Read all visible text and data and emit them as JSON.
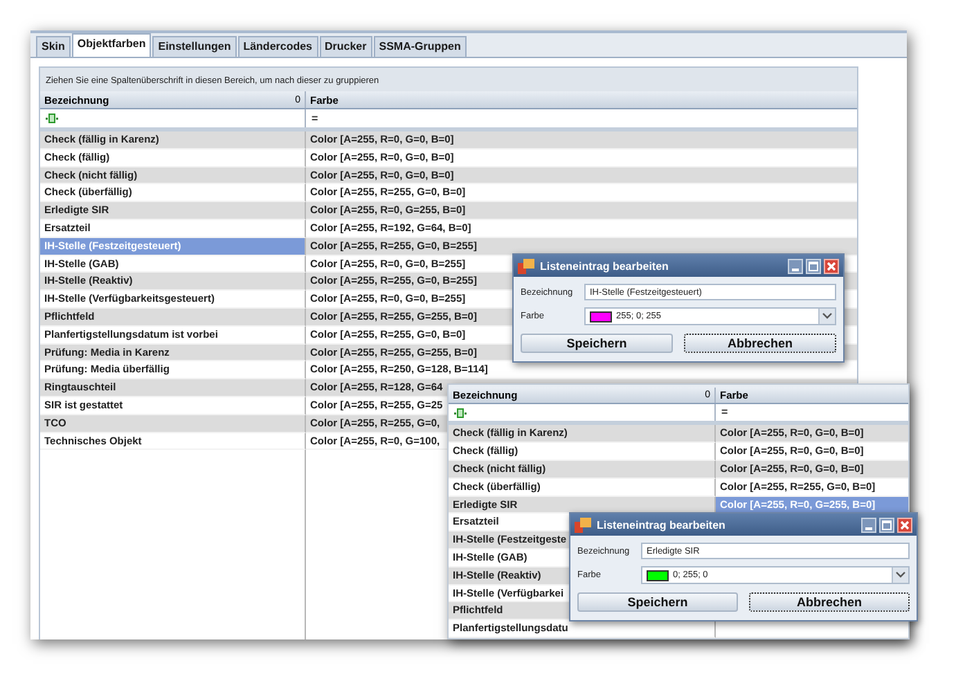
{
  "tabs": [
    {
      "label": "Skin",
      "selected": false
    },
    {
      "label": "Objektfarben",
      "selected": true
    },
    {
      "label": "Einstellungen",
      "selected": false
    },
    {
      "label": "Ländercodes",
      "selected": false
    },
    {
      "label": "Drucker",
      "selected": false
    },
    {
      "label": "SSMA-Gruppen",
      "selected": false
    }
  ],
  "group_panel": {
    "hint": "Ziehen Sie eine Spaltenüberschrift in diesen Bereich, um nach dieser zu gruppieren"
  },
  "grids": [
    {
      "columns": [
        {
          "label": "Bezeichnung",
          "sort_mark": "0"
        },
        {
          "label": "Farbe"
        }
      ],
      "filter_operator": "=",
      "rows": [
        {
          "name": "Check (fällig in Karenz)",
          "value": "Color [A=255, R=0, G=0, B=0]",
          "name_selected": false
        },
        {
          "name": "Check (fällig)",
          "value": "Color [A=255, R=0, G=0, B=0]",
          "name_selected": false
        },
        {
          "name": "Check (nicht fällig)",
          "value": "Color [A=255, R=0, G=0, B=0]",
          "name_selected": false
        },
        {
          "name": "Check (überfällig)",
          "value": "Color [A=255, R=255, G=0, B=0]",
          "name_selected": false
        },
        {
          "name": "Erledigte SIR",
          "value": "Color [A=255, R=0, G=255, B=0]",
          "name_selected": false
        },
        {
          "name": "Ersatzteil",
          "value": "Color [A=255, R=192, G=64, B=0]",
          "name_selected": false
        },
        {
          "name": "IH-Stelle (Festzeitgesteuert)",
          "value": "Color [A=255, R=255, G=0, B=255]",
          "name_selected": true
        },
        {
          "name": "IH-Stelle (GAB)",
          "value": "Color [A=255, R=0, G=0, B=255]",
          "name_selected": false
        },
        {
          "name": "IH-Stelle (Reaktiv)",
          "value": "Color [A=255, R=255, G=0, B=255]",
          "name_selected": false
        },
        {
          "name": "IH-Stelle (Verfügbarkeitsgesteuert)",
          "value": "Color [A=255, R=0, G=0, B=255]",
          "name_selected": false
        },
        {
          "name": "Pflichtfeld",
          "value": "Color [A=255, R=255, G=255, B=0]",
          "name_selected": false
        },
        {
          "name": "Planfertigstellungsdatum ist vorbei",
          "value": "Color [A=255, R=255, G=0, B=0]",
          "name_selected": false
        },
        {
          "name": "Prüfung: Media in Karenz",
          "value": "Color [A=255, R=255, G=255, B=0]",
          "name_selected": false
        },
        {
          "name": "Prüfung: Media überfällig",
          "value": "Color [A=255, R=250, G=128, B=114]",
          "name_selected": false
        },
        {
          "name": "Ringtauschteil",
          "value": "Color [A=255, R=128, G=64",
          "name_selected": false
        },
        {
          "name": "SIR ist gestattet",
          "value": "Color [A=255, R=255, G=25",
          "name_selected": false
        },
        {
          "name": "TCO",
          "value": "Color [A=255, R=255, G=0,",
          "name_selected": false
        },
        {
          "name": "Technisches Objekt",
          "value": "Color [A=255, R=0, G=100,",
          "name_selected": false
        }
      ]
    },
    {
      "columns": [
        {
          "label": "Bezeichnung",
          "sort_mark": "0"
        },
        {
          "label": "Farbe"
        }
      ],
      "filter_operator": "=",
      "rows": [
        {
          "name": "Check (fällig in Karenz)",
          "value": "Color [A=255, R=0, G=0, B=0]",
          "value_selected": false
        },
        {
          "name": "Check (fällig)",
          "value": "Color [A=255, R=0, G=0, B=0]",
          "value_selected": false
        },
        {
          "name": "Check (nicht fällig)",
          "value": "Color [A=255, R=0, G=0, B=0]",
          "value_selected": false
        },
        {
          "name": "Check (überfällig)",
          "value": "Color [A=255, R=255, G=0, B=0]",
          "value_selected": false
        },
        {
          "name": "Erledigte SIR",
          "value": "Color [A=255, R=0, G=255, B=0]",
          "value_selected": true
        },
        {
          "name": "Ersatzteil"
        },
        {
          "name": "IH-Stelle (Festzeitgeste"
        },
        {
          "name": "IH-Stelle (GAB)"
        },
        {
          "name": "IH-Stelle (Reaktiv)"
        },
        {
          "name": "IH-Stelle (Verfügbarkei"
        },
        {
          "name": "Pflichtfeld"
        },
        {
          "name": "Planfertigstellungsdatu"
        }
      ]
    }
  ],
  "dialogs": [
    {
      "title": "Listeneintrag bearbeiten",
      "name_label": "Bezeichnung",
      "name_value": "IH-Stelle (Festzeitgesteuert)",
      "color_label": "Farbe",
      "color": "#ff00ff",
      "color_value": "255; 0; 255",
      "buttons": [
        "Speichern",
        "Abbrechen"
      ]
    },
    {
      "title": "Listeneintrag bearbeiten",
      "name_label": "Bezeichnung",
      "name_value": "Erledigte SIR",
      "color_label": "Farbe",
      "color": "#00ff00",
      "color_value": "0; 255; 0",
      "buttons": [
        "Speichern",
        "Abbrechen"
      ]
    }
  ]
}
